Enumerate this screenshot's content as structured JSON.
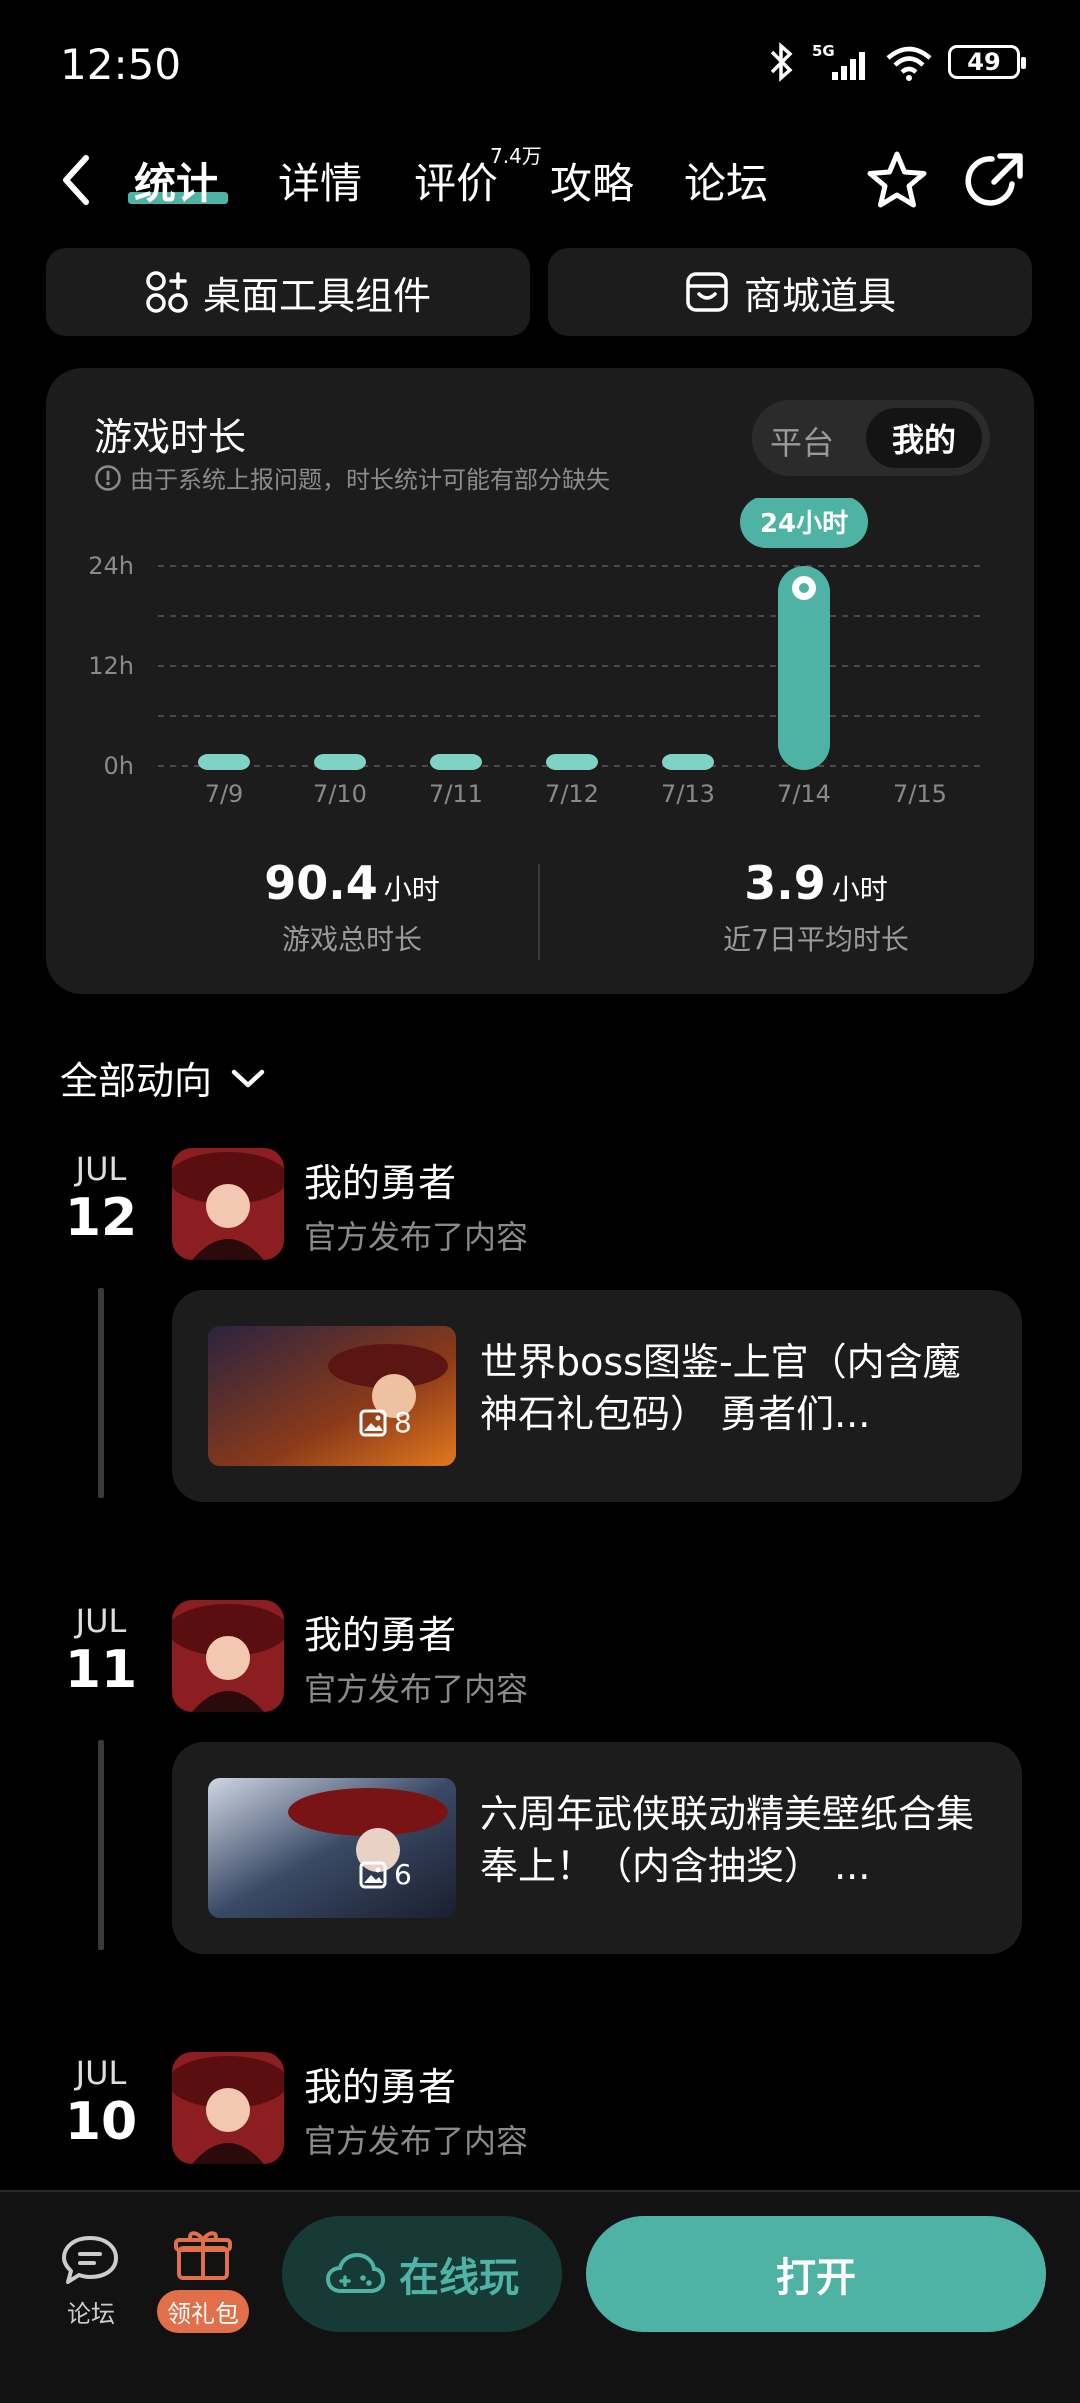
{
  "status": {
    "time": "12:50",
    "network": "5G",
    "battery": "49"
  },
  "nav": {
    "tabs": [
      {
        "label": "统计"
      },
      {
        "label": "详情"
      },
      {
        "label": "评价",
        "badge": "7.4万"
      },
      {
        "label": "攻略"
      },
      {
        "label": "论坛"
      }
    ]
  },
  "tools": {
    "widget_label": "桌面工具组件",
    "store_label": "商城道具"
  },
  "stats": {
    "title": "游戏时长",
    "note": "由于系统上报问题，时长统计可能有部分缺失",
    "toggle": {
      "opt1": "平台",
      "opt2": "我的"
    },
    "total_value": "90.4",
    "total_unit": "小时",
    "total_label": "游戏总时长",
    "avg_value": "3.9",
    "avg_unit": "小时",
    "avg_label": "近7日平均时长"
  },
  "chart_data": {
    "type": "bar",
    "categories": [
      "7/9",
      "7/10",
      "7/11",
      "7/12",
      "7/13",
      "7/14",
      "7/15"
    ],
    "values": [
      0.5,
      0.5,
      0.5,
      1.0,
      0.5,
      24,
      0
    ],
    "y_ticks": [
      "24h",
      "12h",
      "0h"
    ],
    "ylim": [
      0,
      24
    ],
    "highlight_label": "24小时",
    "bar_color": "#7fd3c6",
    "highlight_color": "#4eb3a4",
    "grid": "dashed"
  },
  "feed": {
    "header": "全部动向",
    "items": [
      {
        "mon": "JUL",
        "day": "12",
        "title": "我的勇者",
        "sub": "官方发布了内容",
        "count": "8",
        "text": "世界boss图鉴-上官（内含魔神石礼包码） 勇者们..."
      },
      {
        "mon": "JUL",
        "day": "11",
        "title": "我的勇者",
        "sub": "官方发布了内容",
        "count": "6",
        "text": "六周年武侠联动精美壁纸合集奉上！（内含抽奖） ..."
      },
      {
        "mon": "JUL",
        "day": "10",
        "title": "我的勇者",
        "sub": "官方发布了内容"
      }
    ]
  },
  "bottom": {
    "forum": "论坛",
    "gift": "领礼包",
    "online": "在线玩",
    "open": "打开"
  }
}
